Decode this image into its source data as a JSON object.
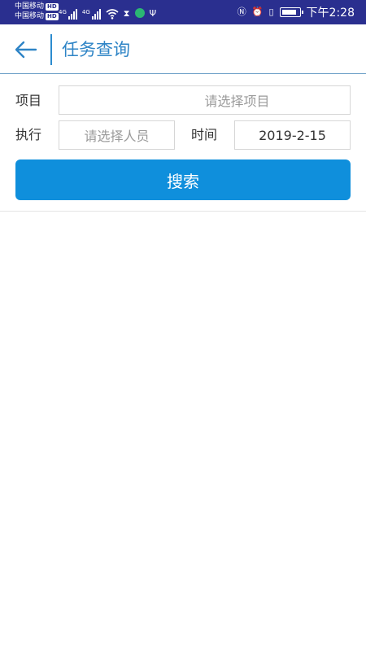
{
  "status_bar": {
    "carrier_1": "中国移动",
    "carrier_2": "中国移动",
    "hd_badge": "HD",
    "signal_label": "4G",
    "nfc_glyph": "Ⓝ",
    "alarm_glyph": "⏰",
    "vibrate_glyph": "▯",
    "hourglass_glyph": "⧗",
    "usb_glyph": "Ψ",
    "time": "下午2:28"
  },
  "app_bar": {
    "title": "任务查询"
  },
  "form": {
    "project_label": "项目",
    "project_placeholder": "请选择项目",
    "executor_label": "执行",
    "executor_placeholder": "请选择人员",
    "time_label": "时间",
    "time_value": "2019-2-15",
    "search_label": "搜索"
  },
  "colors": {
    "status_bar_bg": "#2a2f8f",
    "accent": "#2e84c6",
    "button_bg": "#0f8fdc"
  }
}
